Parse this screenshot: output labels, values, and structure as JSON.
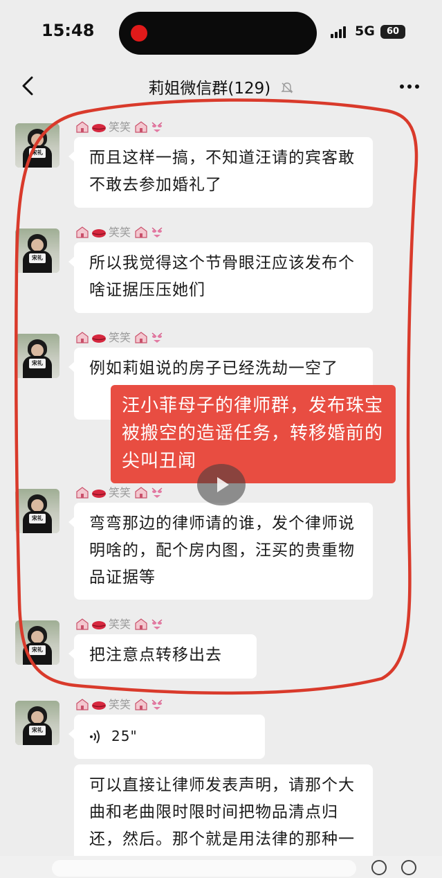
{
  "status": {
    "time": "15:48",
    "network": "5G",
    "battery": "60"
  },
  "header": {
    "title": "莉姐微信群(129)"
  },
  "messages": [
    {
      "sender": "笑笑",
      "text": "而且这样一搞，不知道汪请的宾客敢不敢去参加婚礼了"
    },
    {
      "sender": "笑笑",
      "text": "所以我觉得这个节骨眼汪应该发布个啥证据压压她们"
    },
    {
      "sender": "笑笑",
      "text": "例如莉姐说的房子已经洗劫一空了"
    },
    {
      "sender": "笑笑",
      "text": "弯弯那边的律师请的谁，发个律师说明啥的，配个房内图，汪买的贵重物品证据等"
    },
    {
      "sender": "笑笑",
      "text": "把注意点转移出去"
    },
    {
      "sender": "笑笑",
      "voice_duration": "25\""
    },
    {
      "text": "可以直接让律师发表声明，请那个大曲和老曲限时限时间把物品清点归还，然后。那个就是用法律的那种一主主主发诗念说明"
    }
  ],
  "overlay": {
    "note": "汪小菲母子的律师群，发布珠宝被搬空的造谣任务，转移婚前的尖叫丑闻"
  },
  "avatar_badge": "宋礼",
  "colors": {
    "annotation_red": "#d93a2b",
    "note_bg": "#e8483c",
    "bubble": "#ffffff",
    "chat_bg": "#ededed"
  },
  "icons": [
    "back-arrow-icon",
    "mute-bell-icon",
    "more-dots-icon",
    "house-emoji-icon",
    "lips-emoji-icon",
    "bikini-emoji-icon",
    "voice-wave-icon",
    "play-icon"
  ]
}
